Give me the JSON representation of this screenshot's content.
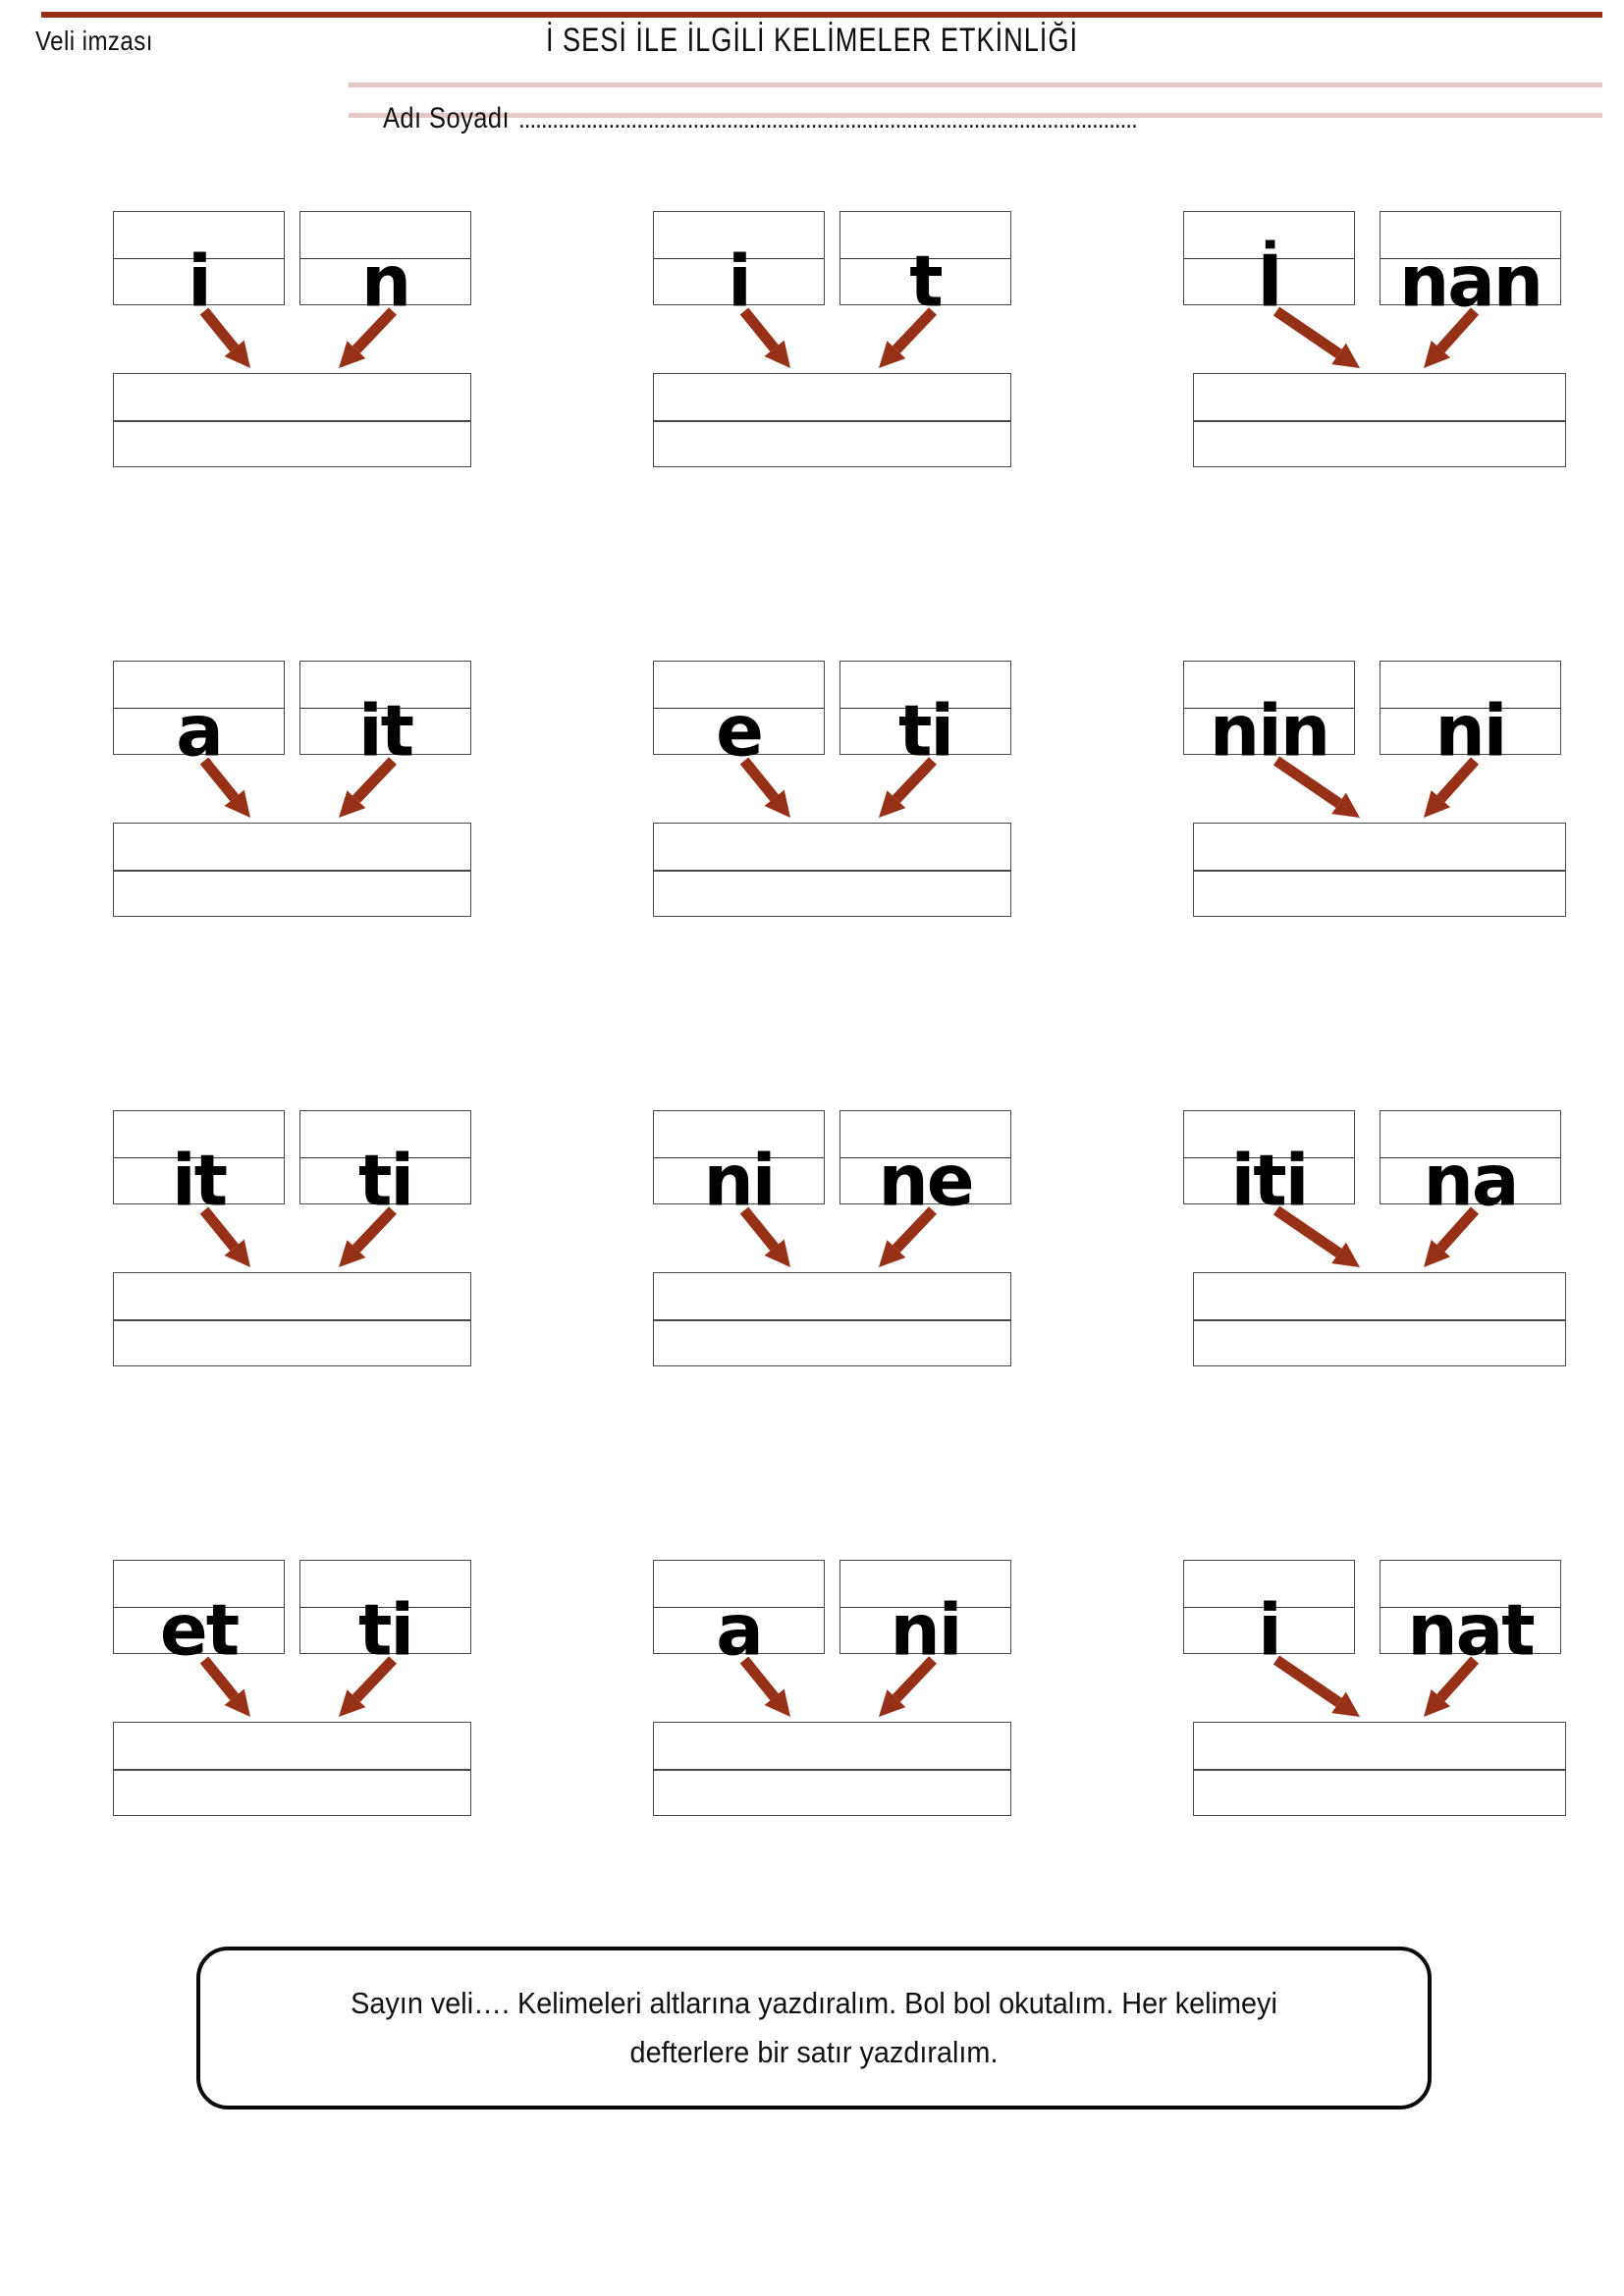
{
  "header": {
    "parent_signature_label": "Veli imzası",
    "title": "İ SESİ İLE İLGİLİ KELİMELER ETKİNLİĞİ",
    "name_label": "Adı Soyadı",
    "name_dots": "..............................................................................................................",
    "rule_color": "#963117",
    "pink_rule_color": "#e4c8c5"
  },
  "exercises": {
    "arrow_color": "#963117",
    "box_border_color": "#4a4a4a",
    "rows": [
      {
        "cells": [
          {
            "left_syllable": "i",
            "right_syllable": "n",
            "answer": ""
          },
          {
            "left_syllable": "i",
            "right_syllable": "t",
            "answer": ""
          },
          {
            "left_syllable": "İ",
            "right_syllable": "nan",
            "answer": ""
          }
        ]
      },
      {
        "cells": [
          {
            "left_syllable": "a",
            "right_syllable": "it",
            "answer": ""
          },
          {
            "left_syllable": "e",
            "right_syllable": "ti",
            "answer": ""
          },
          {
            "left_syllable": "nin",
            "right_syllable": "ni",
            "answer": ""
          }
        ]
      },
      {
        "cells": [
          {
            "left_syllable": "it",
            "right_syllable": "ti",
            "answer": ""
          },
          {
            "left_syllable": "ni",
            "right_syllable": "ne",
            "answer": ""
          },
          {
            "left_syllable": "iti",
            "right_syllable": "na",
            "answer": ""
          }
        ]
      },
      {
        "cells": [
          {
            "left_syllable": "et",
            "right_syllable": "ti",
            "answer": ""
          },
          {
            "left_syllable": "a",
            "right_syllable": "ni",
            "answer": ""
          },
          {
            "left_syllable": "i",
            "right_syllable": "nat",
            "answer": ""
          }
        ]
      }
    ]
  },
  "instruction": {
    "text": "Sayın veli…. Kelimeleri altlarına yazdıralım. Bol bol okutalım. Her kelimeyi defterlere bir satır yazdıralım."
  }
}
